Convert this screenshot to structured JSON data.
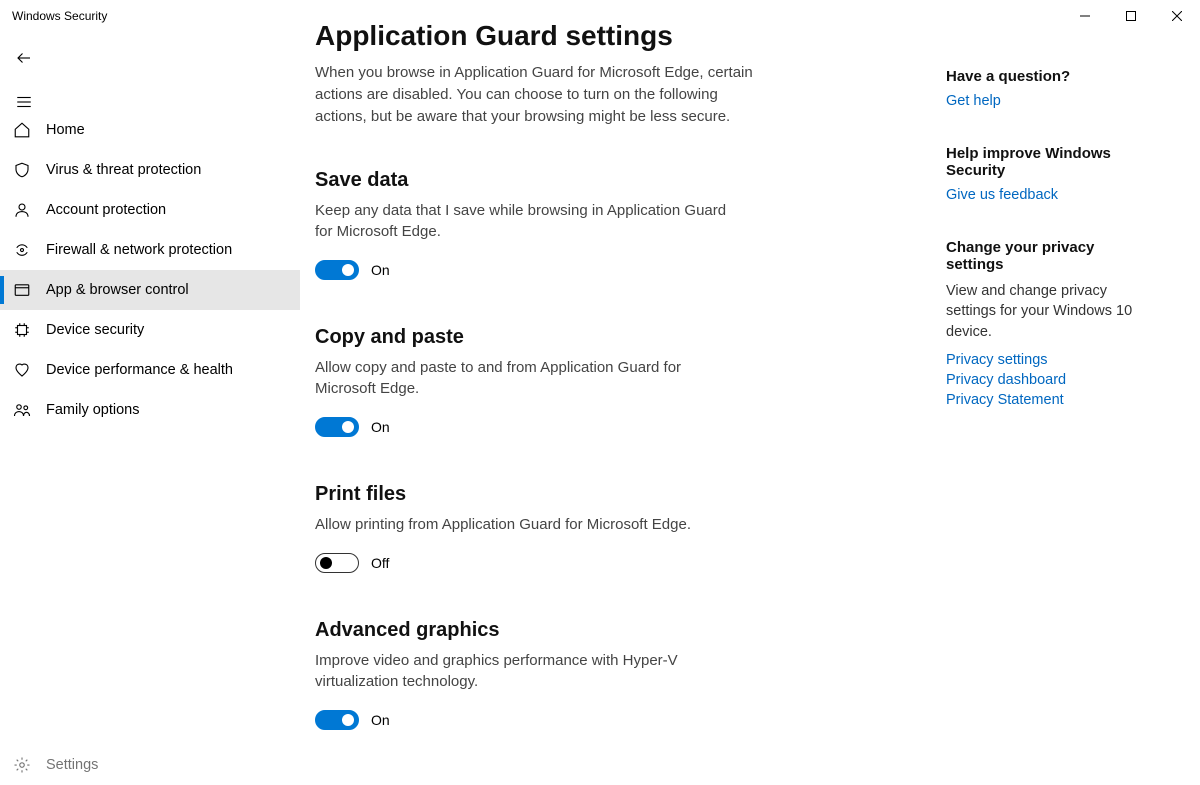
{
  "window": {
    "title": "Windows Security",
    "controls": {
      "min": "─",
      "max": "▢",
      "close": "✕"
    }
  },
  "top": {
    "back": "←",
    "menu": "≡"
  },
  "nav": [
    {
      "id": "home",
      "label": "Home"
    },
    {
      "id": "virus",
      "label": "Virus & threat protection"
    },
    {
      "id": "account",
      "label": "Account protection"
    },
    {
      "id": "firewall",
      "label": "Firewall & network protection"
    },
    {
      "id": "appbrowser",
      "label": "App & browser control",
      "active": true
    },
    {
      "id": "device",
      "label": "Device security"
    },
    {
      "id": "perf",
      "label": "Device performance & health"
    },
    {
      "id": "family",
      "label": "Family options"
    }
  ],
  "settings_row": {
    "label": "Settings"
  },
  "main": {
    "title": "Application Guard settings",
    "intro": "When you browse in Application Guard for Microsoft Edge, certain actions are disabled. You can choose to turn on the following actions, but be aware that your browsing might be less secure.",
    "sections": [
      {
        "title": "Save data",
        "desc": "Keep any data that I save while browsing in Application Guard for Microsoft Edge.",
        "on": true,
        "state_label": "On"
      },
      {
        "title": "Copy and paste",
        "desc": "Allow copy and paste to and from Application Guard for Microsoft Edge.",
        "on": true,
        "state_label": "On"
      },
      {
        "title": "Print files",
        "desc": "Allow printing from Application Guard for Microsoft Edge.",
        "on": false,
        "state_label": "Off"
      },
      {
        "title": "Advanced graphics",
        "desc": "Improve video and graphics performance with Hyper-V virtualization technology.",
        "on": true,
        "state_label": "On"
      }
    ]
  },
  "right": {
    "question": {
      "title": "Have a question?",
      "link": "Get help"
    },
    "improve": {
      "title": "Help improve Windows Security",
      "link": "Give us feedback"
    },
    "privacy": {
      "title": "Change your privacy settings",
      "text": "View and change privacy settings for your Windows 10 device.",
      "links": [
        "Privacy settings",
        "Privacy dashboard",
        "Privacy Statement"
      ]
    }
  }
}
